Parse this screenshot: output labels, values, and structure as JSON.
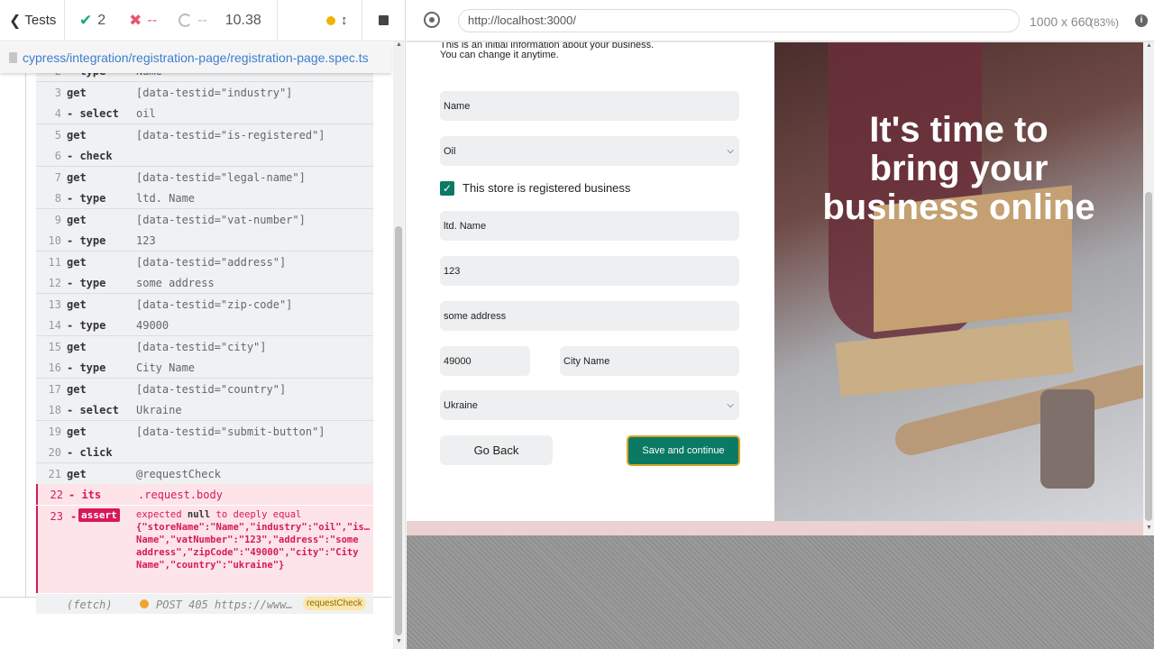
{
  "runner": {
    "back_label": "Tests",
    "passed": "2",
    "failed": "--",
    "pending": "--",
    "duration": "10.38",
    "spec_path": "cypress/integration/registration-page/registration-page.spec.ts"
  },
  "commands": [
    {
      "num": "2",
      "name": "- type",
      "msg": "Name"
    },
    {
      "num": "3",
      "name": "get",
      "msg": "[data-testid=\"industry\"]"
    },
    {
      "num": "4",
      "name": "- select",
      "msg": "oil"
    },
    {
      "num": "5",
      "name": "get",
      "msg": "[data-testid=\"is-registered\"]"
    },
    {
      "num": "6",
      "name": "- check",
      "msg": ""
    },
    {
      "num": "7",
      "name": "get",
      "msg": "[data-testid=\"legal-name\"]"
    },
    {
      "num": "8",
      "name": "- type",
      "msg": "ltd. Name"
    },
    {
      "num": "9",
      "name": "get",
      "msg": "[data-testid=\"vat-number\"]"
    },
    {
      "num": "10",
      "name": "- type",
      "msg": "123"
    },
    {
      "num": "11",
      "name": "get",
      "msg": "[data-testid=\"address\"]"
    },
    {
      "num": "12",
      "name": "- type",
      "msg": "some address"
    },
    {
      "num": "13",
      "name": "get",
      "msg": "[data-testid=\"zip-code\"]"
    },
    {
      "num": "14",
      "name": "- type",
      "msg": "49000"
    },
    {
      "num": "15",
      "name": "get",
      "msg": "[data-testid=\"city\"]"
    },
    {
      "num": "16",
      "name": "- type",
      "msg": "City Name"
    },
    {
      "num": "17",
      "name": "get",
      "msg": "[data-testid=\"country\"]"
    },
    {
      "num": "18",
      "name": "- select",
      "msg": "Ukraine"
    },
    {
      "num": "19",
      "name": "get",
      "msg": "[data-testid=\"submit-button\"]"
    },
    {
      "num": "20",
      "name": "- click",
      "msg": ""
    },
    {
      "num": "21",
      "name": "get",
      "msg": "@requestCheck"
    },
    {
      "num": "22",
      "name": "- its",
      "msg": ".request.body"
    }
  ],
  "assert": {
    "num": "23",
    "dash": "-",
    "badge": "assert",
    "msg_prefix": "expected",
    "msg_null": "null",
    "msg_mid": "to deeply equal",
    "body_lines": [
      "{\"storeName\":\"Name\",\"industry\":\"oil\",\"is…",
      "Name\",\"vatNumber\":\"123\",\"address\":\"some",
      "address\",\"zipCode\":\"49000\",\"city\":\"City",
      "Name\",\"country\":\"ukraine\"}"
    ]
  },
  "fetch": {
    "label": "(fetch)",
    "msg": "POST 405 https://www…",
    "alias": "requestCheck"
  },
  "browser": {
    "url": "http://localhost:3000/",
    "size": "1000 x 660",
    "zoom": "(83%)"
  },
  "app": {
    "intro_line1": "This is an initial information about your business.",
    "intro_line2": "You can change it anytime.",
    "name": "Name",
    "industry": "Oil",
    "checkbox_label": "This store is registered business",
    "legal_name": "ltd. Name",
    "vat": "123",
    "address": "some address",
    "zip": "49000",
    "city": "City Name",
    "country": "Ukraine",
    "back_button": "Go Back",
    "submit_button": "Save and continue",
    "hero_line1": "It's time to",
    "hero_line2": "bring your",
    "hero_line3": "business online"
  },
  "colors": {
    "pass": "#1fa971",
    "fail": "#e45770",
    "accent": "#0a7a64",
    "button_border": "#d9a428",
    "error": "#d6195a"
  }
}
